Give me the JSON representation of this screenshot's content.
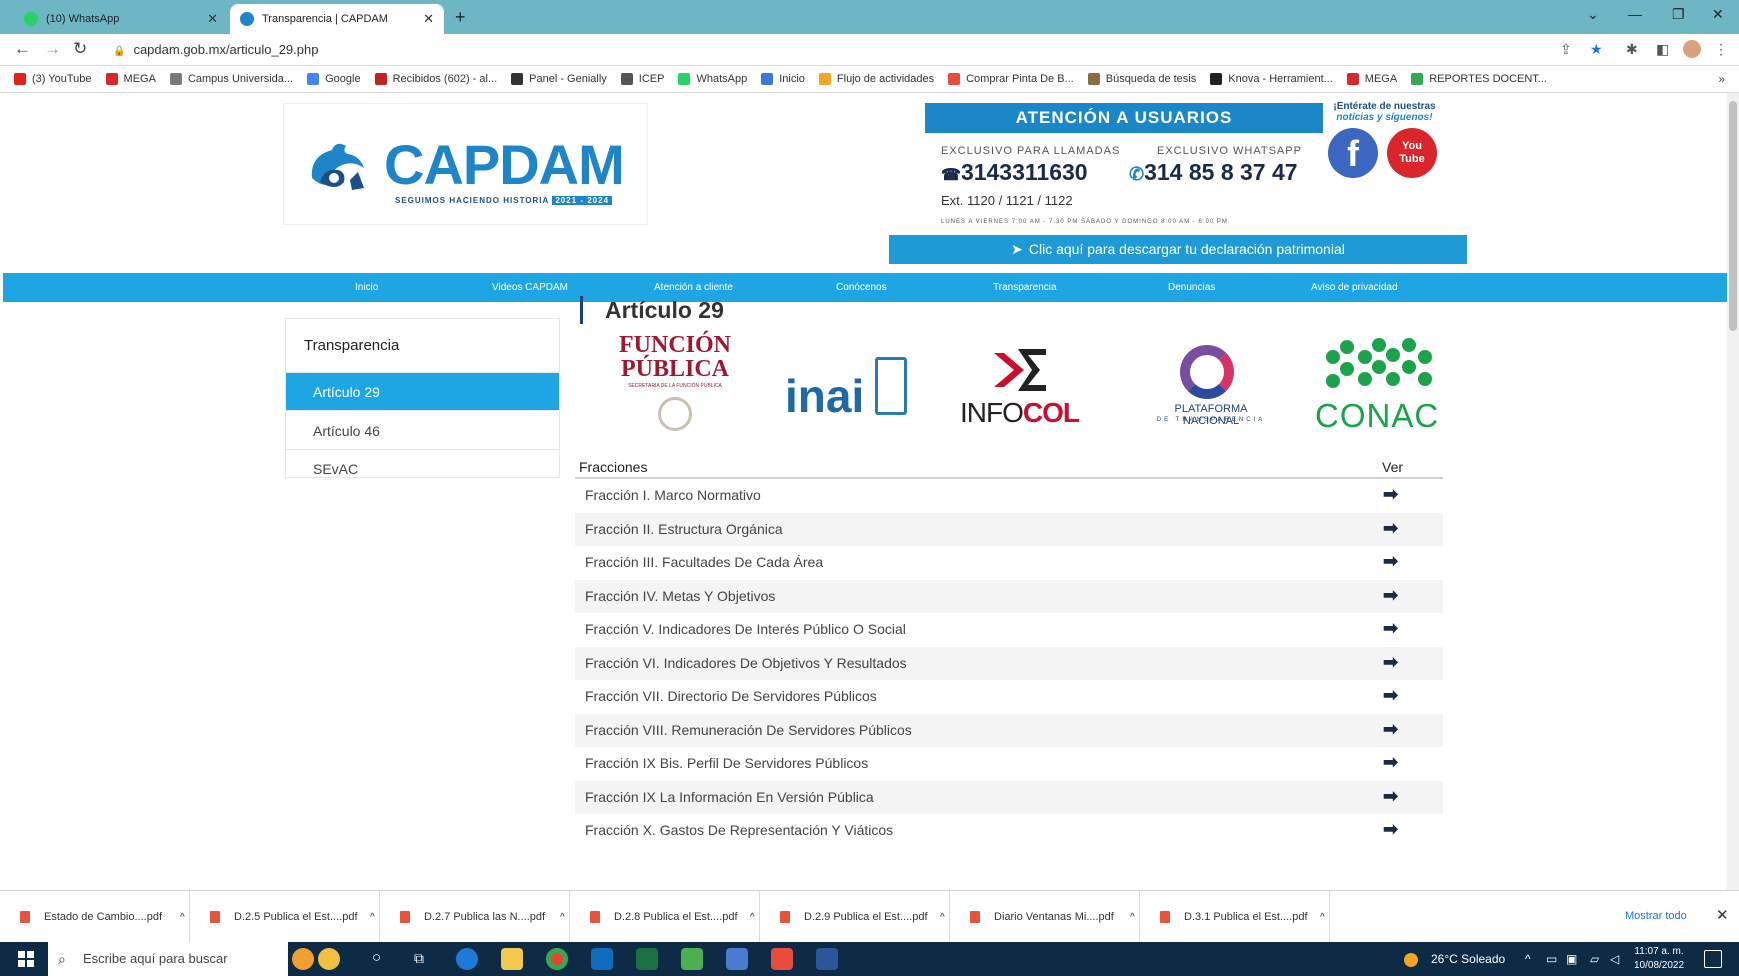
{
  "browser": {
    "tabs": [
      {
        "title": "(10) WhatsApp",
        "active": false
      },
      {
        "title": "Transparencia | CAPDAM",
        "active": true
      }
    ],
    "new_tab": "+",
    "url": "capdam.gob.mx/articulo_29.php",
    "bookmarks": [
      {
        "label": "(3) YouTube",
        "icon": "youtube-icon",
        "color": "#e62117"
      },
      {
        "label": "MEGA",
        "icon": "mega-icon",
        "color": "#d9272e"
      },
      {
        "label": "Campus Universida...",
        "icon": "campus-icon",
        "color": "#7a7a7a"
      },
      {
        "label": "Google",
        "icon": "google-icon",
        "color": "#4285f4"
      },
      {
        "label": "Recibidos (602) - al...",
        "icon": "gmail-icon",
        "color": "#c5221f"
      },
      {
        "label": "Panel - Genially",
        "icon": "genially-icon",
        "color": "#333333"
      },
      {
        "label": "ICEP",
        "icon": "icep-icon",
        "color": "#555555"
      },
      {
        "label": "WhatsApp",
        "icon": "whatsapp-icon",
        "color": "#25d366"
      },
      {
        "label": "Inicio",
        "icon": "inicio-icon",
        "color": "#3a7bd5"
      },
      {
        "label": "Flujo de actividades",
        "icon": "flujo-icon",
        "color": "#f5a623"
      },
      {
        "label": "Comprar Pinta De B...",
        "icon": "shop-icon",
        "color": "#e84c3d"
      },
      {
        "label": "Búsqueda de tesis",
        "icon": "tesis-icon",
        "color": "#8a6d3b"
      },
      {
        "label": "Knova - Herramient...",
        "icon": "knova-icon",
        "color": "#222222"
      },
      {
        "label": "MEGA",
        "icon": "mega-icon",
        "color": "#d9272e"
      },
      {
        "label": "REPORTES DOCENT...",
        "icon": "drive-icon",
        "color": "#34a853"
      }
    ],
    "more": "»"
  },
  "header": {
    "logo_text": "CAPDAM",
    "slogan": "SEGUIMOS HACIENDO HISTORIA",
    "years": "2021 - 2024",
    "atencion_title": "ATENCIÓN A USUARIOS",
    "calls_label": "EXCLUSIVO PARA LLAMADAS",
    "calls_number": "3143311630",
    "whatsapp_label": "EXCLUSIVO WHATSAPP",
    "whatsapp_number": "314 85 8 37 47",
    "extensions": "Ext. 1120 / 1121 / 1122",
    "hours": "LUNES A VIERNES 7:00 AM - 7:30 PM   SÁBADO Y DOMINGO 8:00 AM - 6:00 PM",
    "social_line1": "¡Entérate de nuestras",
    "social_line2": "noticias y síguenos!",
    "youtube_line1": "You",
    "youtube_line2": "Tube",
    "facebook_letter": "f",
    "declaration_banner": "Clic aquí para descargar tu declaración patrimonial"
  },
  "nav": [
    "Inicio",
    "Videos CAPDAM",
    "Atención a cliente",
    "Conócenos",
    "Transparencia",
    "Denuncias",
    "Aviso de privacidad"
  ],
  "sidebar": {
    "title": "Transparencia",
    "items": [
      {
        "label": "Artículo 29",
        "active": true
      },
      {
        "label": "Artículo 46",
        "active": false
      },
      {
        "label": "SEvAC",
        "active": false
      }
    ]
  },
  "main": {
    "title": "Artículo 29",
    "logos": {
      "funcion_line1": "FUNCIÓN",
      "funcion_line2": "PÚBLICA",
      "funcion_sub": "SECRETARÍA DE LA FUNCIÓN PÚBLICA",
      "inai": "inai",
      "infocol_a": "INFO",
      "infocol_b": "COL",
      "pnt_title": "PLATAFORMA NACIONAL",
      "pnt_sub": "DE TRANSPARENCIA",
      "conac": "CONAC"
    },
    "table": {
      "col_fracciones": "Fracciones",
      "col_ver": "Ver",
      "rows": [
        "Fracción I. Marco Normativo",
        "Fracción II. Estructura Orgánica",
        "Fracción III. Facultades De Cada Área",
        "Fracción IV. Metas Y Objetivos",
        "Fracción V. Indicadores De Interés Público O Social",
        "Fracción VI. Indicadores De Objetivos Y Resultados",
        "Fracción VII. Directorio De Servidores Públicos",
        "Fracción VIII. Remuneración De Servidores Públicos",
        "Fracción IX Bis. Perfil De Servidores Públicos",
        "Fracción IX La Información En Versión Pública",
        "Fracción X. Gastos De Representación Y Viáticos"
      ]
    }
  },
  "downloads": {
    "items": [
      "Estado de Cambio....pdf",
      "D.2.5 Publica el Est....pdf",
      "D.2.7 Publica las N....pdf",
      "D.2.8 Publica el Est....pdf",
      "D.2.9 Publica el Est....pdf",
      "Diario Ventanas Mi....pdf",
      "D.3.1 Publica el Est....pdf"
    ],
    "show_all": "Mostrar todo"
  },
  "taskbar": {
    "search_placeholder": "Escribe aquí para buscar",
    "weather": "26°C  Soleado",
    "time": "11:07 a. m.",
    "date": "10/08/2022"
  }
}
